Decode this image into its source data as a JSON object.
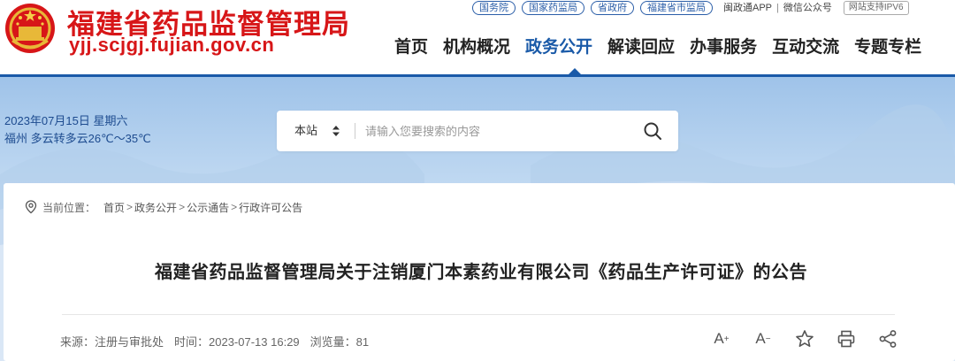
{
  "site": {
    "name": "福建省药品监督管理局",
    "url": "yjj.scjgj.fujian.gov.cn"
  },
  "top_links": {
    "boxed": [
      "国务院",
      "国家药监局",
      "省政府",
      "福建省市监局"
    ],
    "app": "闽政通APP",
    "separator": "|",
    "wechat": "微信公众号",
    "ipv6": "网站支持IPV6"
  },
  "nav": {
    "items": [
      "首页",
      "机构概况",
      "政务公开",
      "解读回应",
      "办事服务",
      "互动交流",
      "专题专栏"
    ],
    "active_index": 2,
    "accent_color": "#1a5aa8"
  },
  "weather": {
    "date": "2023年07月15日 星期六",
    "forecast": "福州 多云转多云26℃～35℃"
  },
  "search": {
    "scope": "本站",
    "placeholder": "请输入您要搜索的内容",
    "button_icon": "search-icon"
  },
  "breadcrumb": {
    "label": "当前位置：",
    "items": [
      "首页",
      "政务公开",
      "公示通告",
      "行政许可公告"
    ],
    "separator": ">"
  },
  "article": {
    "title": "福建省药品监督管理局关于注销厦门本素药业有限公司《药品生产许可证》的公告",
    "source": "来源：注册与审批处",
    "time": "时间：2023-07-13 16:29",
    "views": "浏览量：81"
  },
  "tools": {
    "font_larger": "A",
    "font_smaller": "A",
    "icons": [
      "font-increase-icon",
      "font-decrease-icon",
      "star-icon",
      "print-icon",
      "share-icon"
    ]
  },
  "colors": {
    "brand_red": "#d71618",
    "brand_blue": "#1a5aa8"
  }
}
